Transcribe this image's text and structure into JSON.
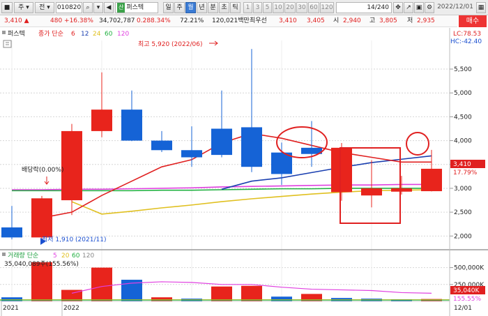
{
  "toolbar": {
    "tool1": "■",
    "sel1": "주",
    "sel2": "전",
    "code": "010820",
    "sector_badge": "산",
    "name": "퍼스텍",
    "periods": [
      "일",
      "주",
      "월",
      "년",
      "분",
      "초",
      "틱"
    ],
    "active_period": "월",
    "nums": [
      "1",
      "3",
      "5",
      "10",
      "20",
      "30",
      "60",
      "120"
    ],
    "page": "14/240",
    "date": "2022/12/01"
  },
  "buy_button": "매수",
  "info": {
    "price": "3,410 ▲",
    "change": "480 +16.38%",
    "volume": "34,702,787",
    "volume_ratio": "0.288.34%",
    "rate": "72.21%",
    "amount": "120,021백만",
    "hoga_label": "최우선",
    "ask": "3,410",
    "bid": "3,405",
    "open_label": "시",
    "open": "2,940",
    "high_label": "고",
    "high": "3,805",
    "low_label": "저",
    "low": "2,935"
  },
  "chart_title": "퍼스텍",
  "ma_legend": {
    "label": "종가 단순",
    "periods": [
      "6",
      "12",
      "24",
      "60",
      "120"
    ],
    "colors": [
      "#e02020",
      "#1a3fb0",
      "#e0c020",
      "#20b040",
      "#e040e0"
    ]
  },
  "lc": "LC:78.53",
  "hc": "HC:-42.40",
  "annotations": {
    "high": "최고 5,920 (2022/06)",
    "low": "최저 1,910 (2021/11)",
    "dividend": "배당락(0.00%)"
  },
  "price_tag": "3,410",
  "pct_tag": "17.79%",
  "vol_legend": {
    "label": "거래량 단순",
    "periods": [
      "5",
      "20",
      "60",
      "120"
    ],
    "colors": [
      "#e040e0",
      "#e0c020",
      "#20b040",
      "#888888"
    ]
  },
  "vol_value": "35,040,089주(155.56%)",
  "vol_tag": "35,040K",
  "vol_tag2": "155.55%",
  "x_labels": [
    "2021",
    "2022"
  ],
  "x_right_label": "12/01",
  "chart_data": {
    "type": "candlestick",
    "period": "monthly",
    "x": [
      "2021/10",
      "2021/11",
      "2021/12",
      "2022/01",
      "2022/02",
      "2022/03",
      "2022/04",
      "2022/05",
      "2022/06",
      "2022/07",
      "2022/08",
      "2022/09",
      "2022/10",
      "2022/11",
      "2022/12"
    ],
    "open": [
      2180,
      1970,
      2750,
      4200,
      4650,
      4000,
      3800,
      4250,
      4280,
      3750,
      3850,
      2920,
      2850,
      2930,
      2940
    ],
    "close": [
      1970,
      2790,
      4200,
      4650,
      4000,
      3800,
      3650,
      3700,
      3450,
      3300,
      3720,
      3850,
      3000,
      3000,
      3410
    ],
    "high": [
      2630,
      2840,
      4350,
      5430,
      5050,
      4200,
      4300,
      5050,
      5920,
      3960,
      4410,
      3950,
      3590,
      3260,
      3805
    ],
    "low": [
      1930,
      1910,
      2440,
      4070,
      3990,
      3760,
      3450,
      3650,
      3340,
      3070,
      3450,
      2740,
      2600,
      2870,
      2935
    ],
    "y_ticks": [
      2000,
      2500,
      3000,
      3500,
      4000,
      4500,
      5000,
      5500
    ],
    "y_tick_labels": [
      "2,000",
      "2,500",
      "3,000",
      "3,500",
      "4,000",
      "4,500",
      "5,000",
      "5,500"
    ],
    "ylim": [
      1800,
      6100
    ],
    "ma6": [
      null,
      2380,
      2500,
      2850,
      3150,
      3450,
      3600,
      3950,
      4150,
      4050,
      3900,
      3750,
      3650,
      3550,
      3550
    ],
    "ma12": [
      null,
      null,
      null,
      null,
      null,
      null,
      null,
      2980,
      3150,
      3220,
      3330,
      3440,
      3540,
      3610,
      3680
    ],
    "ma24": [
      null,
      null,
      2720,
      2460,
      2520,
      2590,
      2650,
      2720,
      2780,
      2830,
      2880,
      2920,
      2950,
      2960,
      2970
    ],
    "ma60": [
      2950,
      2950,
      2950,
      2950,
      2950,
      2960,
      2960,
      2970,
      2980,
      2990,
      2990,
      3000,
      3000,
      3000,
      3000
    ],
    "ma120": [
      2970,
      2970,
      2980,
      2980,
      2990,
      3000,
      3010,
      3030,
      3040,
      3050,
      3060,
      3070,
      3070,
      3080,
      3080
    ],
    "volume": [
      60,
      580,
      170,
      500,
      320,
      60,
      40,
      220,
      230,
      70,
      110,
      50,
      40,
      30,
      35
    ],
    "volume_up": [
      false,
      true,
      true,
      true,
      false,
      true,
      false,
      true,
      true,
      false,
      true,
      false,
      false,
      false,
      true
    ],
    "vol_ma5": [
      null,
      null,
      120,
      220,
      270,
      290,
      280,
      250,
      250,
      210,
      180,
      170,
      160,
      130,
      120
    ],
    "vol_y_ticks": [
      250000,
      500000
    ],
    "vol_y_tick_labels": [
      "250,000K",
      "500,000K"
    ],
    "vol_ylim": [
      0,
      620
    ]
  }
}
